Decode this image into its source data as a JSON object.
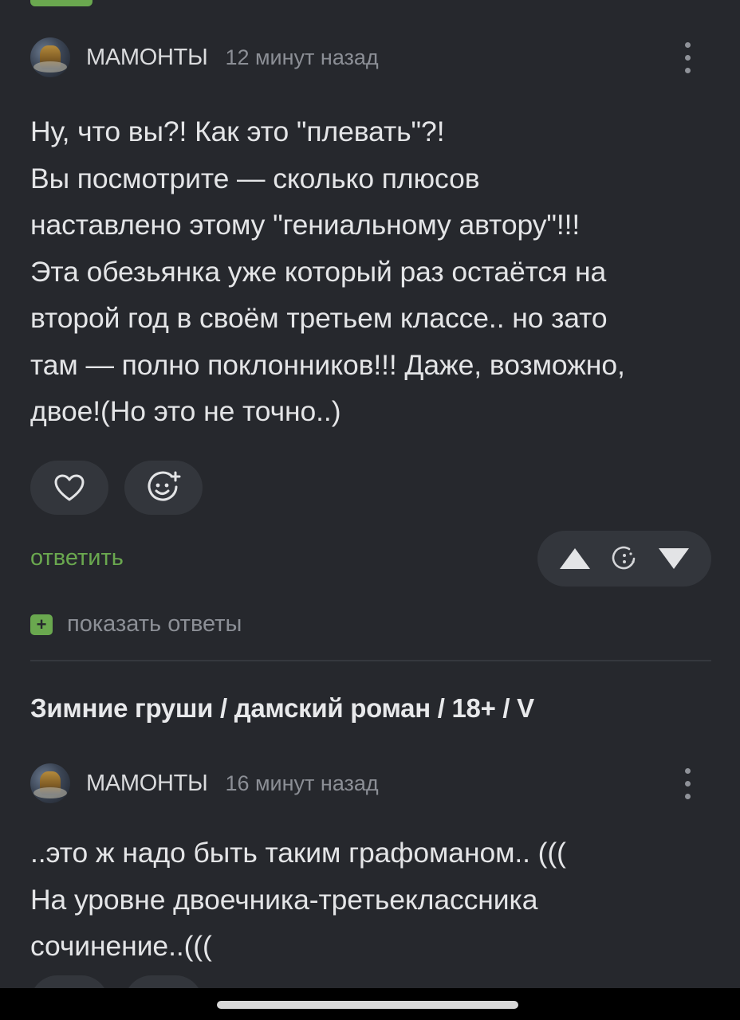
{
  "colors": {
    "background": "#26282d",
    "accent_green": "#6aa84f",
    "button_bg": "#33363c",
    "muted_text": "#8c8f96"
  },
  "comment1": {
    "author": "МАМОНТЫ",
    "time": "12 минут назад",
    "body": "Ну, что вы?! Как это \"плевать\"?!\nВы посмотрите — сколько плюсов\nнаставлено этому \"гениальному автору\"!!!\nЭта обезьянка уже который раз остаётся на\nвторой год в своём третьем классе.. но зато\nтам — полно поклонников!!! Даже, возможно,\nдвое!(Но это не точно..)",
    "like_icon": "heart-icon",
    "emoji_icon": "add-emoji-icon",
    "reply_label": "ответить",
    "vote_icons": [
      "arrow-up-icon",
      "rating-timer-icon",
      "arrow-down-icon"
    ],
    "show_replies_icon": "+",
    "show_replies_label": "показать ответы"
  },
  "post": {
    "title": "Зимние груши / дамский роман / 18+ / V"
  },
  "comment2": {
    "author": "МАМОНТЫ",
    "time": "16 минут назад",
    "body": "..это ж надо быть таким графоманом.. (((\nНа уровне двоечника-третьеклассника\nсочинение..((("
  }
}
